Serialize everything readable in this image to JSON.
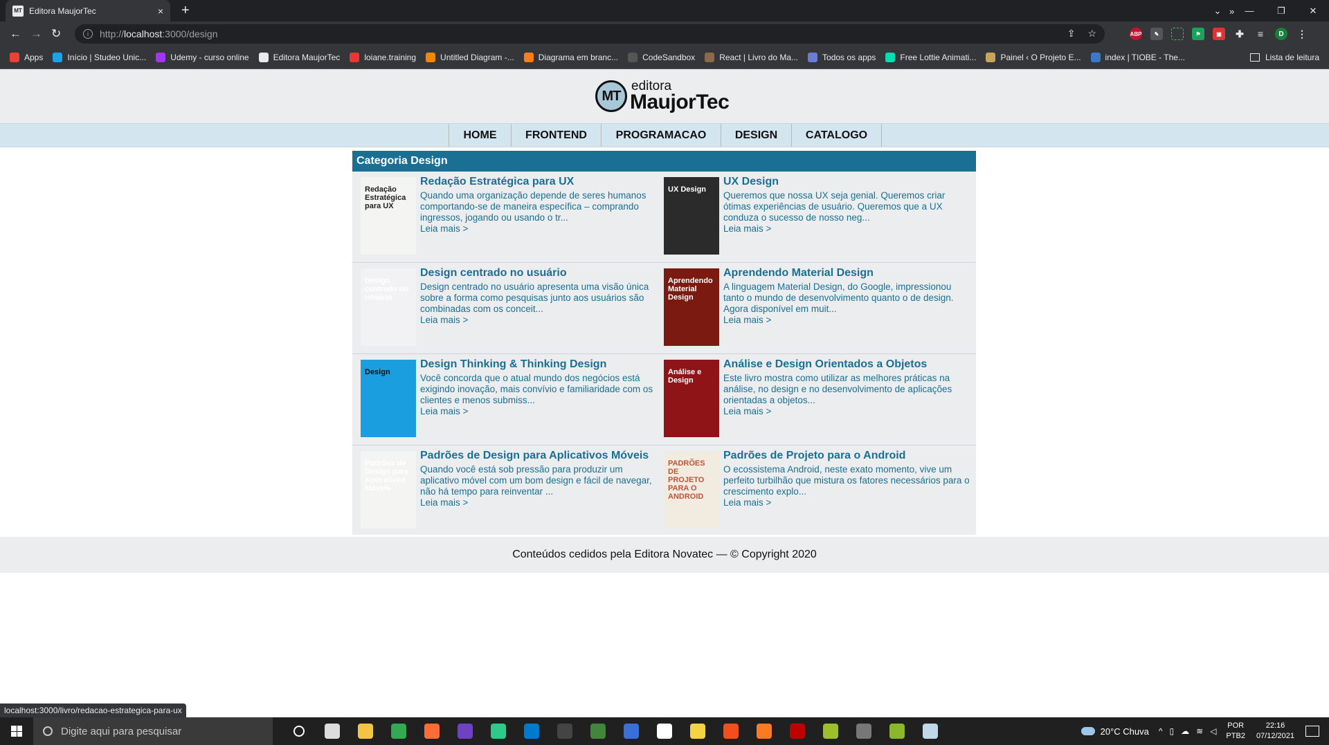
{
  "browser": {
    "tab_title": "Editora MaujorTec",
    "tab_favicon": "MT",
    "new_tab": "+",
    "close_tab": "×",
    "window_controls": [
      "⌄",
      "—",
      "❐",
      "✕"
    ],
    "url_prefix": "http://",
    "url_host": "localhost",
    "url_path": ":3000/design",
    "bookmarks": [
      {
        "label": "Apps",
        "color": "#ea4335"
      },
      {
        "label": "Início | Studeo Unic...",
        "color": "#1aa3e8"
      },
      {
        "label": "Udemy - curso online",
        "color": "#a435f0"
      },
      {
        "label": "Editora MaujorTec",
        "color": "#e8eaed"
      },
      {
        "label": "loiane.training",
        "color": "#e53935"
      },
      {
        "label": "Untitled Diagram -...",
        "color": "#f08705"
      },
      {
        "label": "Diagrama em branc...",
        "color": "#fc7d1a"
      },
      {
        "label": "CodeSandbox",
        "color": "#555555"
      },
      {
        "label": "React | Livro do Ma...",
        "color": "#8a6a4a"
      },
      {
        "label": "Todos os apps",
        "color": "#6b7bd6"
      },
      {
        "label": "Free Lottie Animati...",
        "color": "#00ddb3"
      },
      {
        "label": "Painel ‹ O Projeto E...",
        "color": "#c9a55c"
      },
      {
        "label": "index | TIOBE - The...",
        "color": "#3a78c9"
      }
    ],
    "bookmarks_more": "»",
    "reading_list": "Lista de leitura",
    "status_url": "localhost:3000/livro/redacao-estrategica-para-ux"
  },
  "site": {
    "logo_mark": "MT",
    "logo_small": "editora",
    "logo_big": "MaujorTec",
    "menu": [
      "HOME",
      "FRONTEND",
      "PROGRAMACAO",
      "DESIGN",
      "CATALOGO"
    ],
    "category_title": "Categoria Design",
    "read_more": "Leia mais >",
    "books": [
      {
        "title": "Redação Estratégica para UX",
        "description": "Quando uma organização depende de seres humanos comportando-se de maneira específica – comprando ingressos, jogando ou usando o tr...",
        "cover_bg": "#f4f4f2",
        "cover_text": "Redação Estratégica para UX",
        "cover_text_color": "#222222"
      },
      {
        "title": "UX Design",
        "description": "Queremos que nossa UX seja genial. Queremos criar ótimas experiências de usuário. Queremos que a UX conduza o sucesso de nosso neg...",
        "cover_bg": "#2b2b2b",
        "cover_text": "UX Design",
        "cover_text_color": "#ffffff"
      },
      {
        "title": "Design centrado no usuário",
        "description": "Design centrado no usuário apresenta uma visão única sobre a forma como pesquisas junto aos usuários são combinadas com os conceit...",
        "cover_bg": "#f2f2f4",
        "cover_text": "Design centrado no usuário",
        "cover_text_color": "#ffffff"
      },
      {
        "title": "Aprendendo Material Design",
        "description": "A linguagem Material Design, do Google, impressionou tanto o mundo de desenvolvimento quanto o de design. Agora disponível em muit...",
        "cover_bg": "#7a1a10",
        "cover_text": "Aprendendo Material Design",
        "cover_text_color": "#ffffff"
      },
      {
        "title": "Design Thinking & Thinking Design",
        "description": "Você concorda que o atual mundo dos negócios está exigindo inovação, mais convívio e familiaridade com os clientes e menos submiss...",
        "cover_bg": "#1b9ee0",
        "cover_text": "Design",
        "cover_text_color": "#111111"
      },
      {
        "title": "Análise e Design Orientados a Objetos",
        "description": "Este livro mostra como utilizar as melhores práticas na análise, no design e no desenvolvimento de aplicações orientadas a objetos...",
        "cover_bg": "#8e1418",
        "cover_text": "Análise e Design",
        "cover_text_color": "#ffffff"
      },
      {
        "title": "Padrões de Design para Aplicativos Móveis",
        "description": "Quando você está sob pressão para produzir um aplicativo móvel com um bom design e fácil de navegar, não há tempo para reinventar ...",
        "cover_bg": "#f4f4f2",
        "cover_text": "Padrões de Design para Aplicativos Móveis",
        "cover_text_color": "#ffffff"
      },
      {
        "title": "Padrões de Projeto para o Android",
        "description": "O ecossistema Android, neste exato momento, vive um perfeito turbilhão que mistura os fatores necessários para o crescimento explo...",
        "cover_bg": "#f1ebe0",
        "cover_text": "PADRÕES DE PROJETO PARA O ANDROID",
        "cover_text_color": "#c0533a"
      }
    ],
    "footer": "Conteúdos cedidos pela Editora Novatec — © Copyright 2020"
  },
  "taskbar": {
    "search_placeholder": "Digite aqui para pesquisar",
    "apps": [
      {
        "name": "cortana-icon",
        "color": "#ffffff"
      },
      {
        "name": "task-view-icon",
        "color": "#dddddd"
      },
      {
        "name": "file-explorer-icon",
        "color": "#f4c542"
      },
      {
        "name": "chrome-icon",
        "color": "#34a853"
      },
      {
        "name": "postman-icon",
        "color": "#ff6c37"
      },
      {
        "name": "github-desktop-icon",
        "color": "#6f42c1"
      },
      {
        "name": "git-kraken-icon",
        "color": "#2fc98a"
      },
      {
        "name": "vscode-icon",
        "color": "#007acc"
      },
      {
        "name": "terminal-icon",
        "color": "#444444"
      },
      {
        "name": "nodejs-icon",
        "color": "#43853d"
      },
      {
        "name": "devtools-icon",
        "color": "#3a6fd8"
      },
      {
        "name": "insomnia-icon",
        "color": "#ffffff"
      },
      {
        "name": "sticky-notes-icon",
        "color": "#f5d442"
      },
      {
        "name": "figma-icon",
        "color": "#f24e1e"
      },
      {
        "name": "xampp-icon",
        "color": "#fb7a24"
      },
      {
        "name": "filezilla-icon",
        "color": "#bf0000"
      },
      {
        "name": "lambda-icon",
        "color": "#9cbf2b"
      },
      {
        "name": "game-icon",
        "color": "#777777"
      },
      {
        "name": "mysql-icon",
        "color": "#8bb82b"
      },
      {
        "name": "bird-icon",
        "color": "#c0d8e8"
      }
    ],
    "weather": "20°C  Chuva",
    "lang_1": "POR",
    "lang_2": "PTB2",
    "time": "22:16",
    "date": "07/12/2021"
  }
}
